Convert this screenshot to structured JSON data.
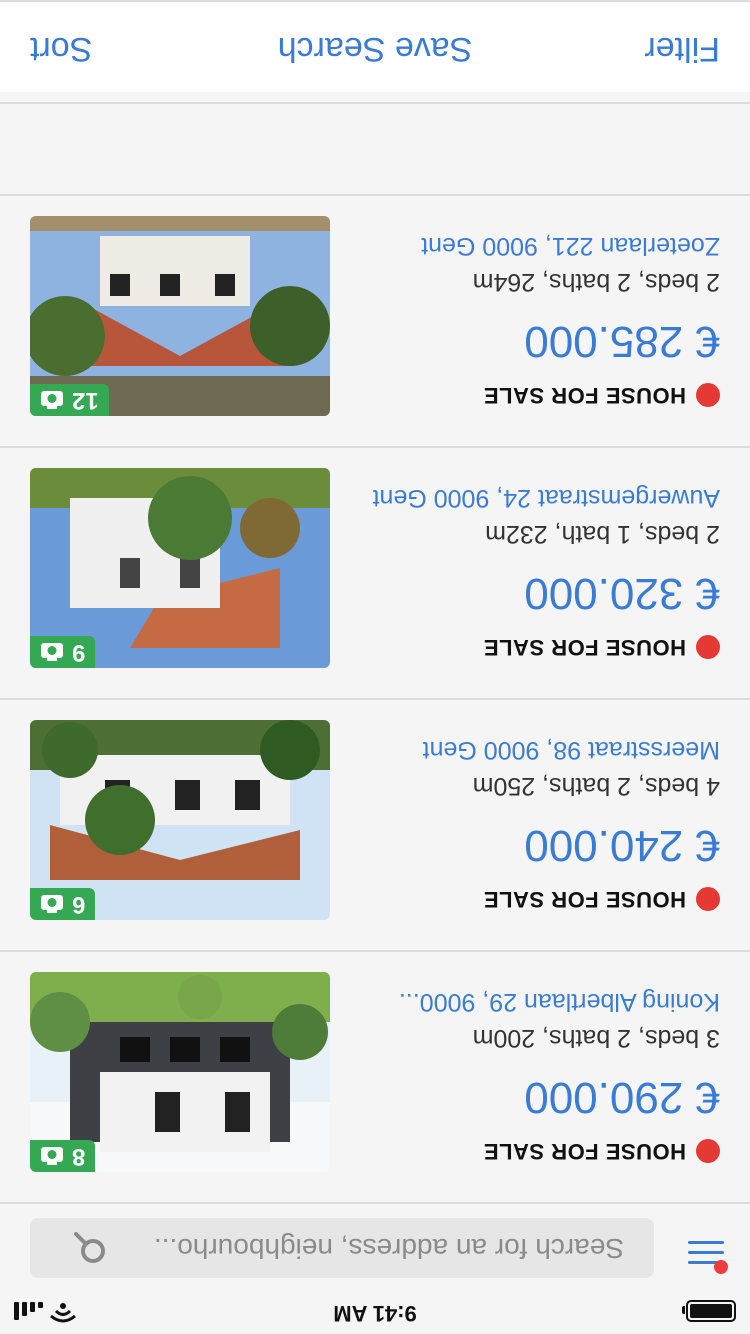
{
  "status_bar": {
    "time": "9:41 AM",
    "icons": [
      "battery-icon",
      "signal-icon",
      "wifi-icon"
    ]
  },
  "search": {
    "placeholder": "Search for an address, neighbourho..."
  },
  "actions": {
    "filter": "Filter",
    "save_search": "Save Search",
    "sort": "Sort"
  },
  "listings": [
    {
      "photo_count": "8",
      "type_label": "HOUSE FOR SALE",
      "price": "€ 290.000",
      "specs": "3 beds, 2 baths, 200m",
      "address": "Koning Albertlaan 29, 9000..."
    },
    {
      "photo_count": "6",
      "type_label": "HOUSE FOR SALE",
      "price": "€ 240.000",
      "specs": "4 beds, 2 baths, 250m",
      "address": "Meersstraat 98, 9000 Gent"
    },
    {
      "photo_count": "9",
      "type_label": "HOUSE FOR SALE",
      "price": "€ 320.000",
      "specs": "2 beds, 1 bath, 232m",
      "address": "Auwergemstraat 24, 9000 Gent"
    },
    {
      "photo_count": "12",
      "type_label": "HOUSE FOR SALE",
      "price": "€ 285.000",
      "specs": "2 beds, 2 baths, 264m",
      "address": "Zoeterlaan 221, 9000 Gent"
    }
  ],
  "colors": {
    "accent": "#3a7bd5",
    "badge_green": "#34a853",
    "status_red": "#e53935"
  }
}
